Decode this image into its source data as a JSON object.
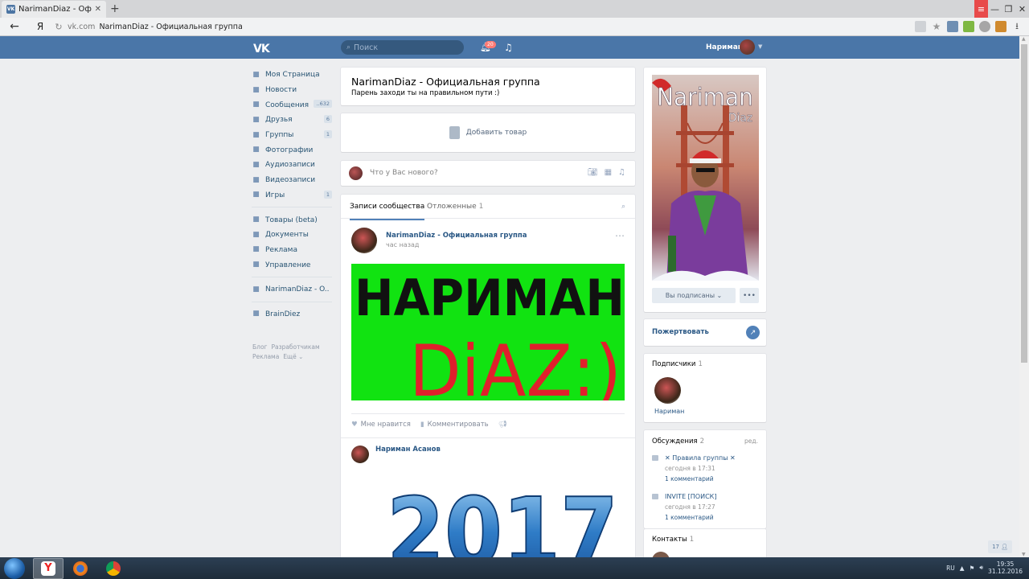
{
  "browser": {
    "tab_title": "NarimanDiaz - Официальн",
    "address_domain": "vk.com",
    "address_title": "NarimanDiaz - Официальная группа",
    "yandex_label": "Я"
  },
  "header": {
    "search_placeholder": "Поиск",
    "notifications_badge": "20",
    "user_name": "Нариман"
  },
  "sidebar": {
    "items": [
      {
        "label": "Моя Страница",
        "icon": "home-icon",
        "count": ""
      },
      {
        "label": "Новости",
        "icon": "news-icon",
        "count": ""
      },
      {
        "label": "Сообщения",
        "icon": "messages-icon",
        "count": "..632"
      },
      {
        "label": "Друзья",
        "icon": "friends-icon",
        "count": "6"
      },
      {
        "label": "Группы",
        "icon": "groups-icon",
        "count": "1"
      },
      {
        "label": "Фотографии",
        "icon": "camera-icon",
        "count": ""
      },
      {
        "label": "Аудиозаписи",
        "icon": "music-icon",
        "count": ""
      },
      {
        "label": "Видеозаписи",
        "icon": "video-icon",
        "count": ""
      },
      {
        "label": "Игры",
        "icon": "gamepad-icon",
        "count": "1"
      }
    ],
    "items2": [
      {
        "label": "Товары (beta)",
        "icon": "goods-icon"
      },
      {
        "label": "Документы",
        "icon": "document-icon"
      },
      {
        "label": "Реклама",
        "icon": "megaphone-icon"
      },
      {
        "label": "Управление",
        "icon": "gamepad-icon"
      }
    ],
    "items3": [
      {
        "label": "NarimanDiaz - O..",
        "icon": "group-icon"
      }
    ],
    "items4": [
      {
        "label": "BrainDiez",
        "icon": "apps-icon"
      }
    ],
    "footer": [
      "Блог",
      "Разработчикам",
      "Реклама",
      "Ещё ⌄"
    ]
  },
  "group": {
    "title": "NarimanDiaz - Официальная группа",
    "status": "Парень заходи ты на правильном пути :)",
    "add_product": "Добавить товар",
    "compose_placeholder": "Что у Вас нового?"
  },
  "feed": {
    "tab_active": "Записи сообщества",
    "tab_other": "Отложенные",
    "tab_other_count": "1",
    "post1": {
      "author": "NarimanDiaz - Официальная группа",
      "time": "час назад",
      "image_text_line1": "НАРИМАН",
      "image_text_line2": "DiAZ:)",
      "like": "Мне нравится",
      "comment": "Комментировать"
    },
    "post2": {
      "author": "Нариман Асанов",
      "image_text": "2017"
    }
  },
  "right": {
    "cover_title": "Nariman",
    "cover_subtitle": "Diaz",
    "subscribed": "Вы подписаны ⌄",
    "more": "•••",
    "donate": "Пожертвовать",
    "subscribers_label": "Подписчики",
    "subscribers_count": "1",
    "subscriber_name": "Нариман",
    "discussions_label": "Обсуждения",
    "discussions_count": "2",
    "discussions_edit": "ред.",
    "topics": [
      {
        "title": "✕ Правила группы ✕",
        "time": "сегодня в 17:31",
        "comments": "1 комментарий"
      },
      {
        "title": "INVITE [ПОИСК]",
        "time": "сегодня в 17:27",
        "comments": "1 комментарий"
      }
    ],
    "contacts_label": "Контакты",
    "contacts_count": "1"
  },
  "online_count": "17",
  "taskbar": {
    "lang": "RU",
    "time": "19:35",
    "date": "31.12.2016"
  },
  "colors": {
    "vk_blue": "#4a76a8",
    "link": "#2a5885",
    "bg": "#edeef0",
    "post_green": "#11e311"
  }
}
